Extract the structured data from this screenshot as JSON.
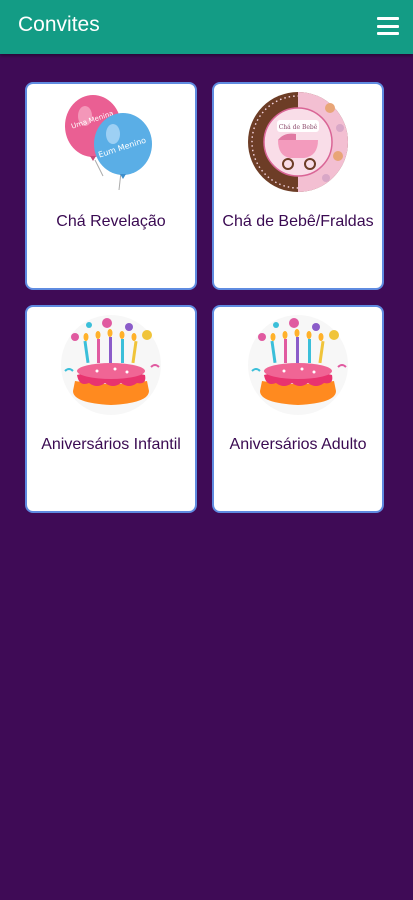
{
  "app": {
    "title": "Convites"
  },
  "header": {
    "menu_icon": "hamburger-menu-icon"
  },
  "colors": {
    "appbar": "#139c85",
    "background": "#3f0b56",
    "card_border": "#5f8be0",
    "label": "#3a0a52"
  },
  "cards": [
    {
      "label": "Chá Revelação",
      "image": "balloons-image",
      "balloon_text_1": "Uma Menina",
      "balloon_text_2": "Eum Menino"
    },
    {
      "label": "Chá de Bebê/Fraldas",
      "image": "baby-stroller-image",
      "badge_text": "Chá de Bebê"
    },
    {
      "label": "Aniversários Infantil",
      "image": "birthday-cake-image"
    },
    {
      "label": "Aniversários Adulto",
      "image": "birthday-cake-image"
    }
  ]
}
